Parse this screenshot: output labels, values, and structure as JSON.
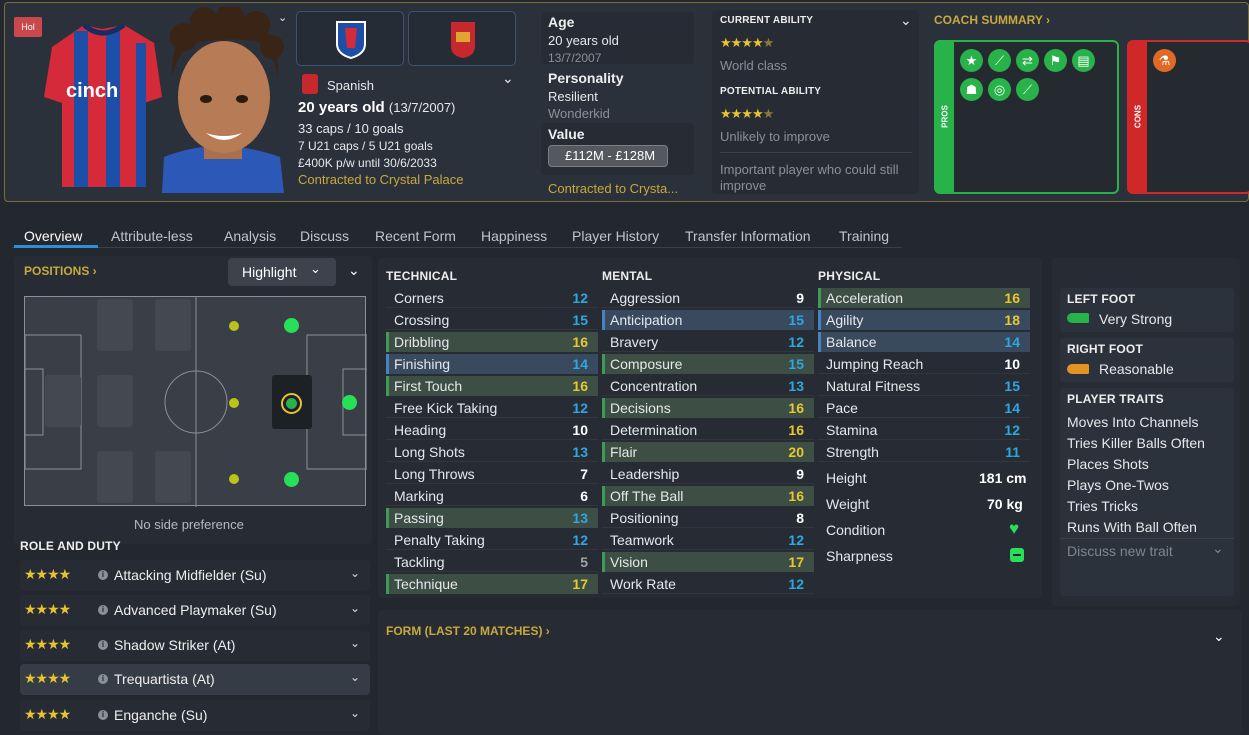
{
  "header": {
    "tag": "Hol",
    "nationality": "Spanish",
    "age_line_bold": "20 years old",
    "age_line_dob": "(13/7/2007)",
    "caps": "33 caps / 10 goals",
    "u21": "7 U21 caps / 5 U21 goals",
    "wage": "£400K p/w until 30/6/2033",
    "contract": "Contracted to Crystal Palace",
    "age_label": "Age",
    "age_value": "20 years old",
    "dob": "13/7/2007",
    "personality_label": "Personality",
    "personality_value": "Resilient",
    "media": "Wonderkid",
    "value_label": "Value",
    "value": "£112M - £128M",
    "contract_short": "Contracted to Crysta..."
  },
  "ability": {
    "current_label": "CURRENT ABILITY",
    "current_stars": 4.5,
    "current_text": "World class",
    "potential_label": "POTENTIAL ABILITY",
    "potential_stars": 4.5,
    "potential_text": "Unlikely to improve",
    "note": "Important player who could still improve"
  },
  "coach": {
    "title": "COACH SUMMARY",
    "pros_label": "PROS",
    "cons_label": "CONS"
  },
  "tabs": [
    "Overview",
    "Attribute-less",
    "Analysis",
    "Discuss",
    "Recent Form",
    "Happiness",
    "Player History",
    "Transfer Information",
    "Training"
  ],
  "positions": {
    "title": "POSITIONS",
    "highlight": "Highlight",
    "side_pref": "No side preference"
  },
  "roles": {
    "title": "ROLE AND DUTY",
    "items": [
      {
        "name": "Attacking Midfielder (Su)",
        "stars": 4
      },
      {
        "name": "Advanced Playmaker (Su)",
        "stars": 4
      },
      {
        "name": "Shadow Striker (At)",
        "stars": 4
      },
      {
        "name": "Trequartista (At)",
        "stars": 4
      },
      {
        "name": "Enganche (Su)",
        "stars": 4
      }
    ]
  },
  "attributes": {
    "technical_title": "TECHNICAL",
    "mental_title": "MENTAL",
    "physical_title": "PHYSICAL",
    "technical": [
      {
        "n": "Corners",
        "v": "12",
        "c": "b",
        "h": ""
      },
      {
        "n": "Crossing",
        "v": "15",
        "c": "b",
        "h": ""
      },
      {
        "n": "Dribbling",
        "v": "16",
        "c": "y",
        "h": "g"
      },
      {
        "n": "Finishing",
        "v": "14",
        "c": "b",
        "h": "b"
      },
      {
        "n": "First Touch",
        "v": "16",
        "c": "y",
        "h": "g"
      },
      {
        "n": "Free Kick Taking",
        "v": "12",
        "c": "b",
        "h": ""
      },
      {
        "n": "Heading",
        "v": "10",
        "c": "w",
        "h": ""
      },
      {
        "n": "Long Shots",
        "v": "13",
        "c": "b",
        "h": ""
      },
      {
        "n": "Long Throws",
        "v": "7",
        "c": "w",
        "h": ""
      },
      {
        "n": "Marking",
        "v": "6",
        "c": "w",
        "h": ""
      },
      {
        "n": "Passing",
        "v": "13",
        "c": "b",
        "h": "g"
      },
      {
        "n": "Penalty Taking",
        "v": "12",
        "c": "b",
        "h": ""
      },
      {
        "n": "Tackling",
        "v": "5",
        "c": "g",
        "h": ""
      },
      {
        "n": "Technique",
        "v": "17",
        "c": "y",
        "h": "g"
      }
    ],
    "mental": [
      {
        "n": "Aggression",
        "v": "9",
        "c": "w",
        "h": ""
      },
      {
        "n": "Anticipation",
        "v": "15",
        "c": "b",
        "h": "b"
      },
      {
        "n": "Bravery",
        "v": "12",
        "c": "b",
        "h": ""
      },
      {
        "n": "Composure",
        "v": "15",
        "c": "b",
        "h": "g"
      },
      {
        "n": "Concentration",
        "v": "13",
        "c": "b",
        "h": ""
      },
      {
        "n": "Decisions",
        "v": "16",
        "c": "y",
        "h": "g"
      },
      {
        "n": "Determination",
        "v": "16",
        "c": "y",
        "h": ""
      },
      {
        "n": "Flair",
        "v": "20",
        "c": "y",
        "h": "g"
      },
      {
        "n": "Leadership",
        "v": "9",
        "c": "w",
        "h": ""
      },
      {
        "n": "Off The Ball",
        "v": "16",
        "c": "y",
        "h": "g"
      },
      {
        "n": "Positioning",
        "v": "8",
        "c": "w",
        "h": ""
      },
      {
        "n": "Teamwork",
        "v": "12",
        "c": "b",
        "h": ""
      },
      {
        "n": "Vision",
        "v": "17",
        "c": "y",
        "h": "g"
      },
      {
        "n": "Work Rate",
        "v": "12",
        "c": "b",
        "h": ""
      }
    ],
    "physical": [
      {
        "n": "Acceleration",
        "v": "16",
        "c": "y",
        "h": "g"
      },
      {
        "n": "Agility",
        "v": "18",
        "c": "y",
        "h": "b"
      },
      {
        "n": "Balance",
        "v": "14",
        "c": "b",
        "h": "b"
      },
      {
        "n": "Jumping Reach",
        "v": "10",
        "c": "w",
        "h": ""
      },
      {
        "n": "Natural Fitness",
        "v": "15",
        "c": "b",
        "h": ""
      },
      {
        "n": "Pace",
        "v": "14",
        "c": "b",
        "h": ""
      },
      {
        "n": "Stamina",
        "v": "12",
        "c": "b",
        "h": ""
      },
      {
        "n": "Strength",
        "v": "11",
        "c": "b",
        "h": ""
      }
    ],
    "height_label": "Height",
    "height": "181 cm",
    "weight_label": "Weight",
    "weight": "70 kg",
    "condition_label": "Condition",
    "sharpness_label": "Sharpness"
  },
  "feet": {
    "left_label": "LEFT FOOT",
    "left": "Very Strong",
    "right_label": "RIGHT FOOT",
    "right": "Reasonable"
  },
  "traits": {
    "title": "PLAYER TRAITS",
    "items": [
      "Moves Into Channels",
      "Tries Killer Balls Often",
      "Places Shots",
      "Plays One-Twos",
      "Tries Tricks",
      "Runs With Ball Often"
    ],
    "discuss": "Discuss new trait"
  },
  "form": {
    "title": "FORM (LAST 20 MATCHES)"
  },
  "colors": {
    "accent": "#c8a93d",
    "blue_value": "#2ea7e0",
    "yellow_value": "#e8c82e",
    "pros": "#27b24a",
    "cons": "#d02828"
  }
}
